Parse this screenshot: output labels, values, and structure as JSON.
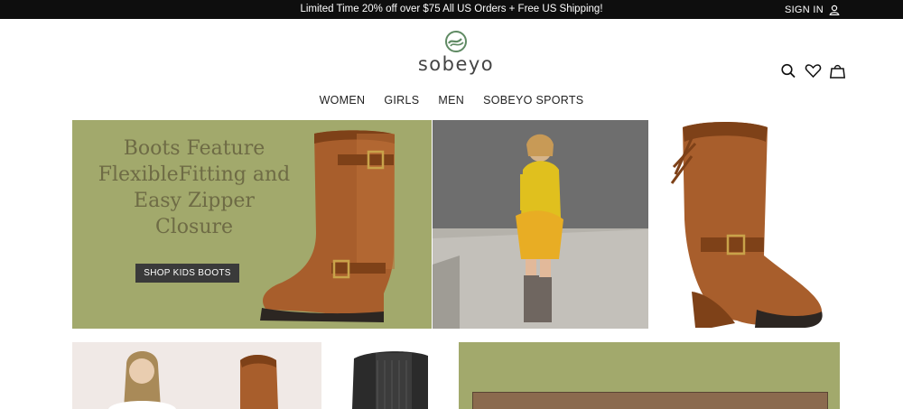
{
  "promo_bar": {
    "text": "Limited Time 20% off over $75 All US Orders + Free US Shipping!",
    "sign_in": "SIGN IN"
  },
  "brand": {
    "logo_text": "sobeyo"
  },
  "nav": {
    "items": [
      "WOMEN",
      "GIRLS",
      "MEN",
      "SOBEYO SPORTS"
    ]
  },
  "hero": {
    "headline_lines": [
      "Boots Feature",
      "FlexibleFitting and",
      "Easy Zipper Closure"
    ],
    "cta_label": "SHOP KIDS BOOTS"
  },
  "icons": {
    "user": "user-icon",
    "search": "search-icon",
    "wishlist": "heart-icon",
    "cart": "shopping-bag-icon",
    "logo_mark": "sobeyo-logo-mark"
  },
  "colors": {
    "top_bar": "#0e0e0e",
    "olive_panel": "#a2a96c",
    "headline_text": "#6e6b45",
    "button": "#3a3a3a",
    "boot_brown": "#a85e2c"
  }
}
